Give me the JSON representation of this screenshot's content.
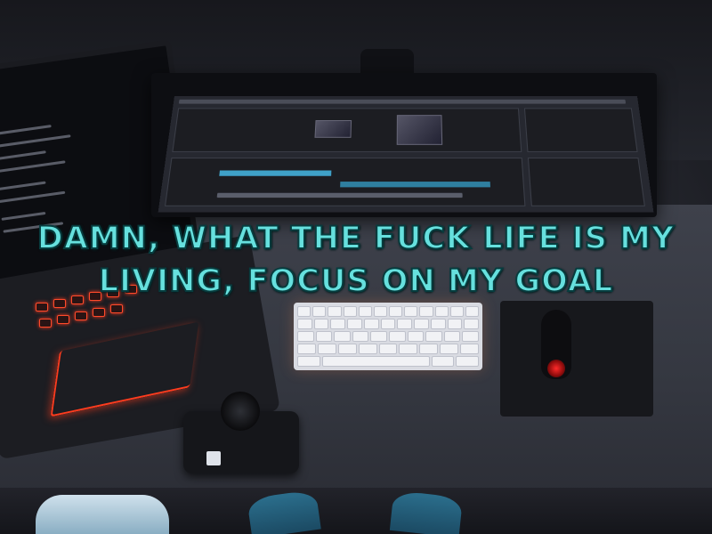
{
  "caption": {
    "line1": "DAMN, WHAT THE FUCK LIFE IS MY",
    "line2": "LIVING, FOCUS ON MY GOAL",
    "color": "#66e0de",
    "outline_color": "#073c3e"
  },
  "scene": {
    "objects": [
      "laptop",
      "monitor",
      "keyboard",
      "mouse",
      "mousepad",
      "camera"
    ],
    "accent_colors": {
      "laptop_backlight": "#ff3c1e",
      "keyboard_backlight": "#ff8c50",
      "mouse_led": "#ff2a2a",
      "editor_highlight": "#3fa1c8"
    }
  }
}
